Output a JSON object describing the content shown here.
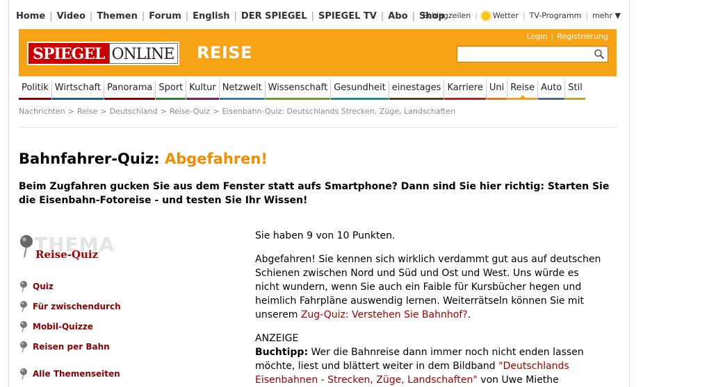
{
  "topnav": {
    "left": [
      "Home",
      "Video",
      "Themen",
      "Forum",
      "English",
      "DER SPIEGEL",
      "SPIEGEL TV",
      "Abo",
      "Shop"
    ],
    "right": {
      "schlagzeilen": "Schlagzeilen",
      "wetter": "Wetter",
      "tv": "TV-Programm",
      "mehr": "mehr ▼"
    }
  },
  "header": {
    "logo_spiegel": "SPIEGEL",
    "logo_online": "ONLINE",
    "section": "REISE",
    "login": "Login",
    "register": "Registrierung",
    "search_placeholder": ""
  },
  "sections": [
    {
      "label": "Politik",
      "color": "#8b0000"
    },
    {
      "label": "Wirtschaft",
      "color": "#1a5e8a"
    },
    {
      "label": "Panorama",
      "color": "#8b0000"
    },
    {
      "label": "Sport",
      "color": "#2e7d32"
    },
    {
      "label": "Kultur",
      "color": "#7b1f5e"
    },
    {
      "label": "Netzwelt",
      "color": "#2f7fb6"
    },
    {
      "label": "Wissenschaft",
      "color": "#6a9c2c"
    },
    {
      "label": "Gesundheit",
      "color": "#1c8f7a"
    },
    {
      "label": "einestages",
      "color": "#5a3d1e"
    },
    {
      "label": "Karriere",
      "color": "#b3261e"
    },
    {
      "label": "Uni",
      "color": "#e57817"
    },
    {
      "label": "Reise",
      "color": "#f7a316",
      "active": true
    },
    {
      "label": "Auto",
      "color": "#4a6a8a"
    },
    {
      "label": "Stil",
      "color": "#c9a227"
    }
  ],
  "breadcrumb": [
    "Nachrichten",
    "Reise",
    "Deutschland",
    "Reise-Quiz",
    "Eisenbahn-Quiz: Deutschlands Strecken, Züge, Landschaften"
  ],
  "article": {
    "headline_a": "Bahnfahrer-Quiz: ",
    "headline_b": "Abgefahren!",
    "intro": "Beim Zugfahren gucken Sie aus dem Fenster statt aufs Smartphone? Dann sind Sie hier richtig: Starten Sie die Eisenbahn-Fotoreise - und testen Sie Ihr Wissen!",
    "score": "Sie haben 9 von 10 Punkten.",
    "result_text": "Abgefahren! Sie kennen sich wirklich verdammt gut aus auf deutschen Schienen zwischen Nord und Süd und Ost und West. Uns würde es nicht wundern, wenn Sie auch ein Faible für Kursbücher hegen und heimlich Fahrpläne auswendig lernen. Weiterrätseln können Sie mit unserem ",
    "result_link": "Zug-Quiz: Verstehen Sie Bahnhof?",
    "result_end": ".",
    "ad_label": "ANZEIGE",
    "book_label": "Buchtipp:",
    "book_text": " Wer die Bahnreise dann immer noch nicht enden lassen möchte, liest und blättert weiter in dem Bildband ",
    "book_link": "\"Deutschlands Eisenbahnen - Strecken, Züge, Landschaften\"",
    "book_end": " von Uwe Miethe"
  },
  "sidebar": {
    "thema_word": "THEMA",
    "thema_title": "Reise-Quiz",
    "links": [
      "Quiz",
      "Für zwischendurch",
      "Mobil-Quizze",
      "Reisen per Bahn",
      "Alle Themenseiten"
    ]
  }
}
